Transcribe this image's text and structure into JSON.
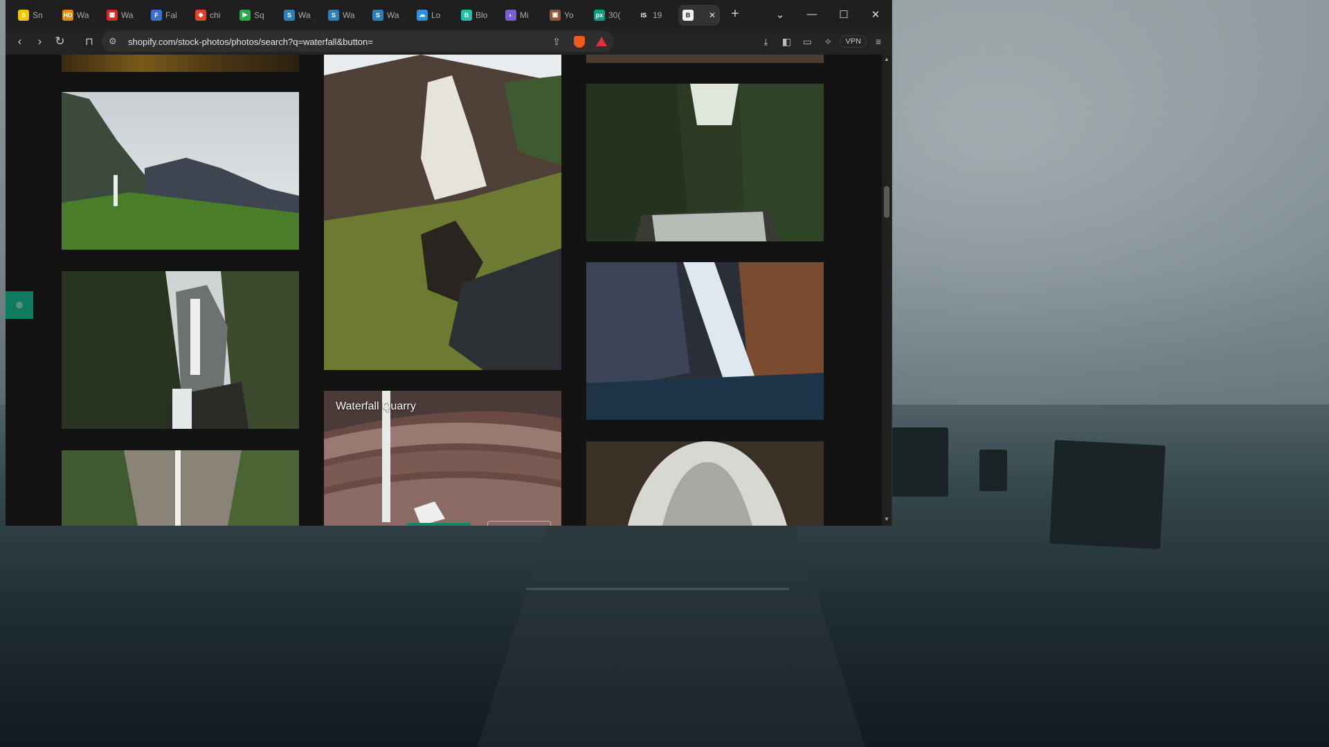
{
  "tabs": [
    {
      "label": "Sn",
      "color": "#f5c400",
      "glyph": "S"
    },
    {
      "label": "Wa",
      "color": "#e88a00",
      "glyph": "HD"
    },
    {
      "label": "Wa",
      "color": "#d42a2a",
      "glyph": "▦"
    },
    {
      "label": "Fal",
      "color": "#3b6fd8",
      "glyph": "F"
    },
    {
      "label": "chi",
      "color": "#e24329",
      "glyph": "◆"
    },
    {
      "label": "Sq",
      "color": "#2aa84a",
      "glyph": "▶"
    },
    {
      "label": "Wa",
      "color": "#2b7fb8",
      "glyph": "S"
    },
    {
      "label": "Wa",
      "color": "#2b7fb8",
      "glyph": "S"
    },
    {
      "label": "Wa",
      "color": "#2b7fb8",
      "glyph": "S"
    },
    {
      "label": "Lo",
      "color": "#2f8fe0",
      "glyph": "☁"
    },
    {
      "label": "Blo",
      "color": "#1fbfa8",
      "glyph": "B"
    },
    {
      "label": "Mi",
      "color": "#7a5fd0",
      "glyph": "◐"
    },
    {
      "label": "Yo",
      "color": "#8a5a3a",
      "glyph": "▣"
    },
    {
      "label": "30(",
      "color": "#05a081",
      "glyph": "px"
    },
    {
      "label": "19",
      "color": "#202020",
      "glyph": "IS"
    }
  ],
  "active_tab": {
    "glyph": "B",
    "close": "✕"
  },
  "new_tab": "+",
  "window_controls": {
    "dropdown": "⌄",
    "minimize": "—",
    "maximize": "☐",
    "close": "✕"
  },
  "toolbar": {
    "back": "‹",
    "forward": "›",
    "reload": "↻",
    "bookmark": "⊓",
    "url": "shopify.com/stock-photos/photos/search?q=waterfall&button=",
    "vpn": "VPN"
  },
  "photos": {
    "waterfall_quarry_caption": "Waterfall Quarry"
  },
  "scroll": {
    "up": "▲",
    "down": "▼"
  }
}
